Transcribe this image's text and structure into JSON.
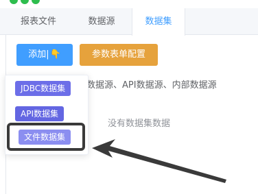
{
  "window": {
    "dot_colors": [
      "#2dbd4e",
      "#2dbd4e",
      "#2dbd4e"
    ]
  },
  "tabs": [
    {
      "label": "报表文件",
      "active": false
    },
    {
      "label": "数据源",
      "active": false
    },
    {
      "label": "数据集",
      "active": true
    }
  ],
  "toolbar": {
    "add_label": "添加|",
    "add_icon": "pointing-hand-icon",
    "config_label": "参数表单配置"
  },
  "info_text": "数据源、API数据源、内部数据源",
  "empty_text": "没有数据集数据",
  "dropdown": {
    "items": [
      {
        "label": "JDBC数据集"
      },
      {
        "label": "API数据集"
      },
      {
        "label": "文件数据集",
        "highlighted": true
      }
    ]
  },
  "colors": {
    "primary": "#409eff",
    "warning": "#e6a23c",
    "menu_item": "#6366e2",
    "menu_item_highlight": "#8b8ef0",
    "annotation": "#3a3a3a"
  }
}
